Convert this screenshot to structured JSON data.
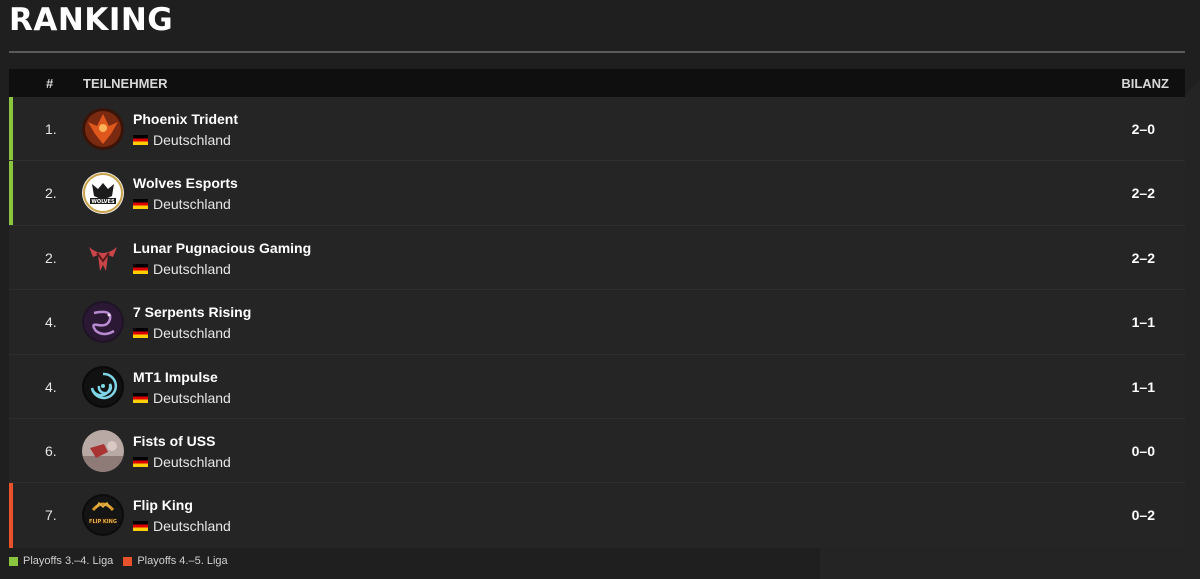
{
  "page": {
    "title": "RANKING"
  },
  "table": {
    "headers": {
      "rank": "#",
      "participant": "TEILNEHMER",
      "record": "BILANZ"
    },
    "rows": [
      {
        "rank": "1.",
        "name": "Phoenix Trident",
        "country": "Deutschland",
        "record": "2–0",
        "marker": "#8bc53f",
        "logo": "phoenix-logo"
      },
      {
        "rank": "2.",
        "name": "Wolves Esports",
        "country": "Deutschland",
        "record": "2–2",
        "marker": "#8bc53f",
        "logo": "wolves-logo"
      },
      {
        "rank": "2.",
        "name": "Lunar Pugnacious Gaming",
        "country": "Deutschland",
        "record": "2–2",
        "marker": "",
        "logo": "lunar-logo"
      },
      {
        "rank": "4.",
        "name": "7 Serpents Rising",
        "country": "Deutschland",
        "record": "1–1",
        "marker": "",
        "logo": "serpent-logo"
      },
      {
        "rank": "4.",
        "name": "MT1 Impulse",
        "country": "Deutschland",
        "record": "1–1",
        "marker": "",
        "logo": "impulse-logo"
      },
      {
        "rank": "6.",
        "name": "Fists of USS",
        "country": "Deutschland",
        "record": "0–0",
        "marker": "",
        "logo": "fists-logo"
      },
      {
        "rank": "7.",
        "name": "Flip King",
        "country": "Deutschland",
        "record": "0–2",
        "marker": "#e8522a",
        "logo": "flipking-logo"
      }
    ]
  },
  "legend": [
    {
      "label": "Playoffs 3.–4. Liga",
      "color": "#8bc53f"
    },
    {
      "label": "Playoffs 4.–5. Liga",
      "color": "#e8522a"
    }
  ]
}
